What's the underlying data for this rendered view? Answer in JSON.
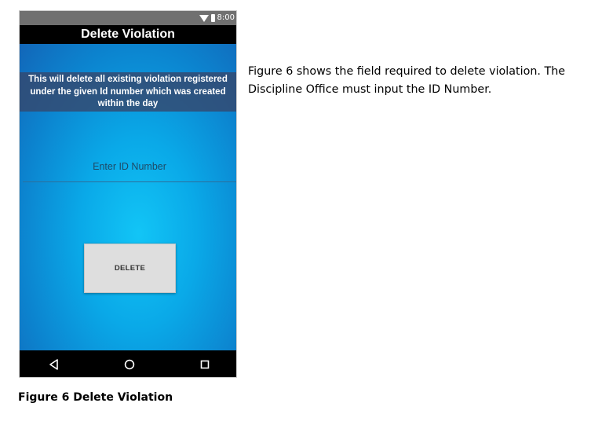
{
  "status_bar": {
    "time": "8:00",
    "icons": [
      "wifi-icon",
      "battery-icon"
    ]
  },
  "app": {
    "title": "Delete Violation",
    "warning_line1": "This will delete all existing violation registered",
    "warning_line2": "under the given Id number which was created",
    "warning_line3": "within the day",
    "id_field": {
      "value": "",
      "placeholder": "Enter ID Number"
    },
    "delete_button_label": "DELETE"
  },
  "nav_bar": {
    "icons": [
      "back-icon",
      "home-icon",
      "recents-icon"
    ]
  },
  "document": {
    "description_line1": "Figure 6 shows the field required to delete violation. The",
    "description_line2": "Discipline Office must input the ID Number.",
    "caption": "Figure 6 Delete Violation"
  },
  "colors": {
    "action_bar": "#000000",
    "status_bar": "#707070",
    "banner": "#34486e",
    "background_blue": "#0aa9e8",
    "button": "#dedede"
  }
}
